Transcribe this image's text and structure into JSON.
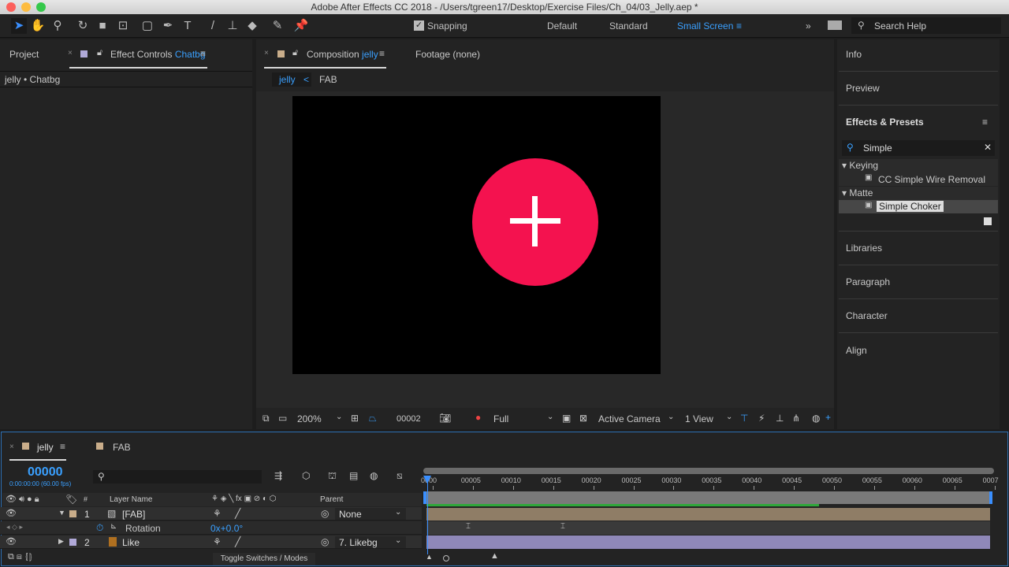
{
  "window": {
    "title": "Adobe After Effects CC 2018 - /Users/tgreen17/Desktop/Exercise Files/Ch_04/03_Jelly.aep *"
  },
  "toolbar": {
    "tools": [
      "selection-icon",
      "hand-icon",
      "zoom-icon",
      "rotate-icon",
      "camera-icon",
      "pan-behind-icon",
      "rectangle-icon",
      "pen-icon",
      "type-icon",
      "brush-icon",
      "clone-stamp-icon",
      "eraser-icon",
      "roto-brush-icon",
      "puppet-pin-icon"
    ],
    "snapping_label": "Snapping",
    "snapping_checked": true,
    "workspaces": [
      "Default",
      "Standard",
      "Small Screen"
    ],
    "active_workspace": "Small Screen",
    "search_help": "Search Help"
  },
  "left_panel": {
    "project_tab": "Project",
    "effect_controls_prefix": "Effect Controls",
    "effect_controls_layer": "Chatbg",
    "breadcrumb": "jelly • Chatbg"
  },
  "comp_panel": {
    "comp_tab_prefix": "Composition",
    "comp_tab_name": "jelly",
    "footage_tab": "Footage (none)",
    "nav": {
      "current": "jelly",
      "sep": "<",
      "child": "FAB"
    },
    "bottom": {
      "zoom": "200%",
      "timecode": "00002",
      "resolution": "Full",
      "camera": "Active Camera",
      "views": "1 View"
    },
    "colors": {
      "fab": "#f4124f",
      "comp_bg": "#000000"
    }
  },
  "right_panel": {
    "info": "Info",
    "preview": "Preview",
    "effects_presets": "Effects & Presets",
    "search_value": "Simple",
    "tree": [
      {
        "category": "Keying",
        "items": [
          "CC Simple Wire Removal"
        ]
      },
      {
        "category": "Matte",
        "items": [
          "Simple Choker"
        ]
      }
    ],
    "selected_effect": "Simple Choker",
    "libraries": "Libraries",
    "paragraph": "Paragraph",
    "character": "Character",
    "align": "Align"
  },
  "timeline": {
    "tabs": [
      "jelly",
      "FAB"
    ],
    "active_tab": "jelly",
    "timecode": "00000",
    "timecode_sub": "0:00:00:00 (60.00 fps)",
    "columns": {
      "layer_name": "Layer Name",
      "parent": "Parent",
      "num": "#"
    },
    "layers": [
      {
        "num": "1",
        "name": "[FAB]",
        "parent": "None",
        "color": "#c9ad8a"
      },
      {
        "num": "2",
        "name": "Like",
        "parent": "7. Likebg",
        "color": "#b0a9d8"
      }
    ],
    "property": {
      "name": "Rotation",
      "value": "0x+0.0°"
    },
    "ruler": [
      "0000",
      "00005",
      "00010",
      "00015",
      "00020",
      "00025",
      "00030",
      "00035",
      "00040",
      "00045",
      "00050",
      "00055",
      "00060",
      "00065",
      "0007"
    ],
    "toggle_label": "Toggle Switches / Modes"
  }
}
